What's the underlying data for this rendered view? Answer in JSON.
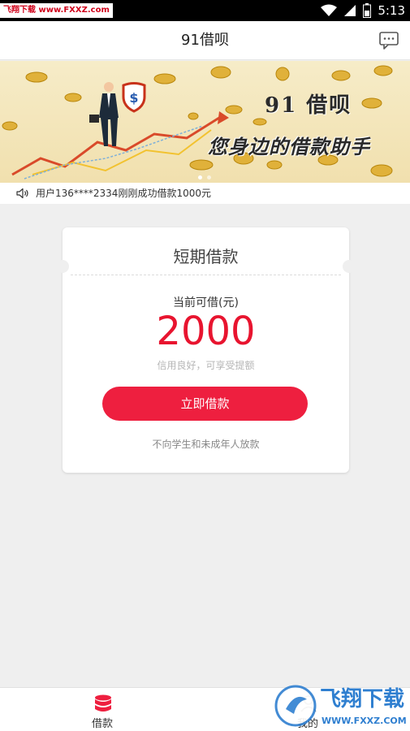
{
  "status_bar": {
    "watermark": "飞翔下载 www.FXXZ.com",
    "time": "5:13"
  },
  "header": {
    "title": "91借呗",
    "message_icon": "chat-icon"
  },
  "banner": {
    "title": "91 借呗",
    "slogan": "您身边的借款助手",
    "dots": 2,
    "active_dot": 0
  },
  "notice": {
    "icon": "speaker-icon",
    "text": "用户136****2334刚刚成功借款1000元"
  },
  "loan_card": {
    "title": "短期借款",
    "available_label": "当前可借(元)",
    "amount": "2000",
    "credit_hint": "信用良好，可享受提额",
    "button_label": "立即借款",
    "disclaimer": "不向学生和未成年人放款"
  },
  "tabbar": {
    "tabs": [
      {
        "label": "借款",
        "icon": "database-icon",
        "active": true
      },
      {
        "label": "我的",
        "icon": "user-icon",
        "active": false
      }
    ]
  },
  "watermark_bottom": {
    "text": "飞翔下载",
    "url": "WWW.FXXZ.COM"
  },
  "colors": {
    "accent": "#ee1f3f",
    "amount": "#e8142f",
    "background": "#efefef"
  }
}
